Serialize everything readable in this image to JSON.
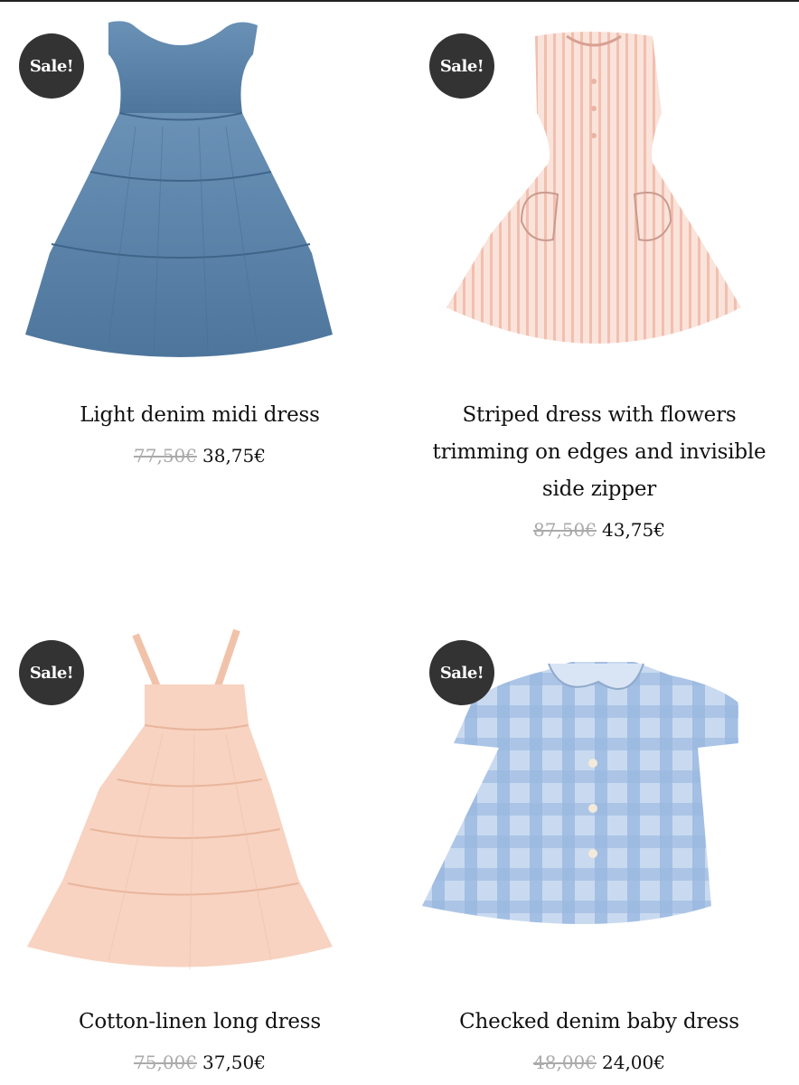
{
  "badge_label": "Sale!",
  "products": [
    {
      "title": "Light denim midi dress",
      "old_price": "77,50€",
      "price": "38,75€",
      "color": "#5b84aa"
    },
    {
      "title": "Striped dress with flowers trimming on edges and invisible side zipper",
      "old_price": "87,50€",
      "price": "43,75€",
      "color": "#f6d8cf"
    },
    {
      "title": "Cotton-linen long dress",
      "old_price": "75,00€",
      "price": "37,50€",
      "color": "#f8d3c1"
    },
    {
      "title": "Checked denim baby dress",
      "old_price": "48,00€",
      "price": "24,00€",
      "color": "#a9c3e5"
    }
  ]
}
